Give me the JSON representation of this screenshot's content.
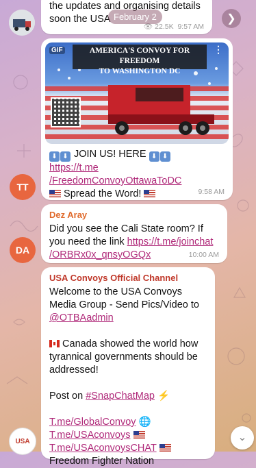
{
  "date_pill": "February 2",
  "top_message": {
    "partial_line1": "the updates and organising details",
    "partial_line2": "soon the USA",
    "views": "22.5K",
    "time": "9:57 AM"
  },
  "gif_message": {
    "gif_badge": "GIF",
    "banner_line1": "AMERICA'S CONVOY FOR FREEDOM",
    "banner_line2": "TO WASHINGTON DC",
    "join_text": "JOIN US! HERE",
    "link_line1": "https://t.me",
    "link_line2": "/FreedomConvoyOttawaToDC",
    "spread_text": "Spread the Word!",
    "time": "9:58 AM",
    "avatar_initials": "TT",
    "avatar_color": "#e8663f"
  },
  "dez_message": {
    "sender": "Dez Aray",
    "sender_color": "#e06a2c",
    "line1": "Did you see the Cali State room? If",
    "line2_text": "you need the link ",
    "link_line1": "https://t.me/joinchat",
    "link_line2": "/ORBRx0x_qnsyOGQx",
    "time": "10:00 AM",
    "avatar_initials": "DA",
    "avatar_color": "#e8663f"
  },
  "channel_message": {
    "sender": "USA Convoys Official Channel",
    "sender_color": "#c0392b",
    "p1_line1": "Welcome to the USA Convoys",
    "p1_line2": "Media Group  - Send Pics/Video to",
    "p1_mention": "@OTBAadmin",
    "p2_line1": "Canada showed the world how",
    "p2_line2": "tyrannical governments should be",
    "p2_line3": "addressed!",
    "p3_text": "Post on ",
    "p3_hashtag": "#SnapChatMap",
    "link1": "T.me/GlobalConvoy",
    "link2": "T.me/USAconvoys",
    "link3": "T.me/USAconvoysCHAT",
    "last_line": "Freedom Fighter Nation",
    "avatar_label": "USA"
  },
  "accent_link_color": "#b02a7a",
  "icons": [
    "share-arrow-icon",
    "views-eye-icon",
    "more-menu-icon",
    "scroll-down-icon",
    "qr-code-icon",
    "lightning-icon",
    "globe-icon"
  ]
}
